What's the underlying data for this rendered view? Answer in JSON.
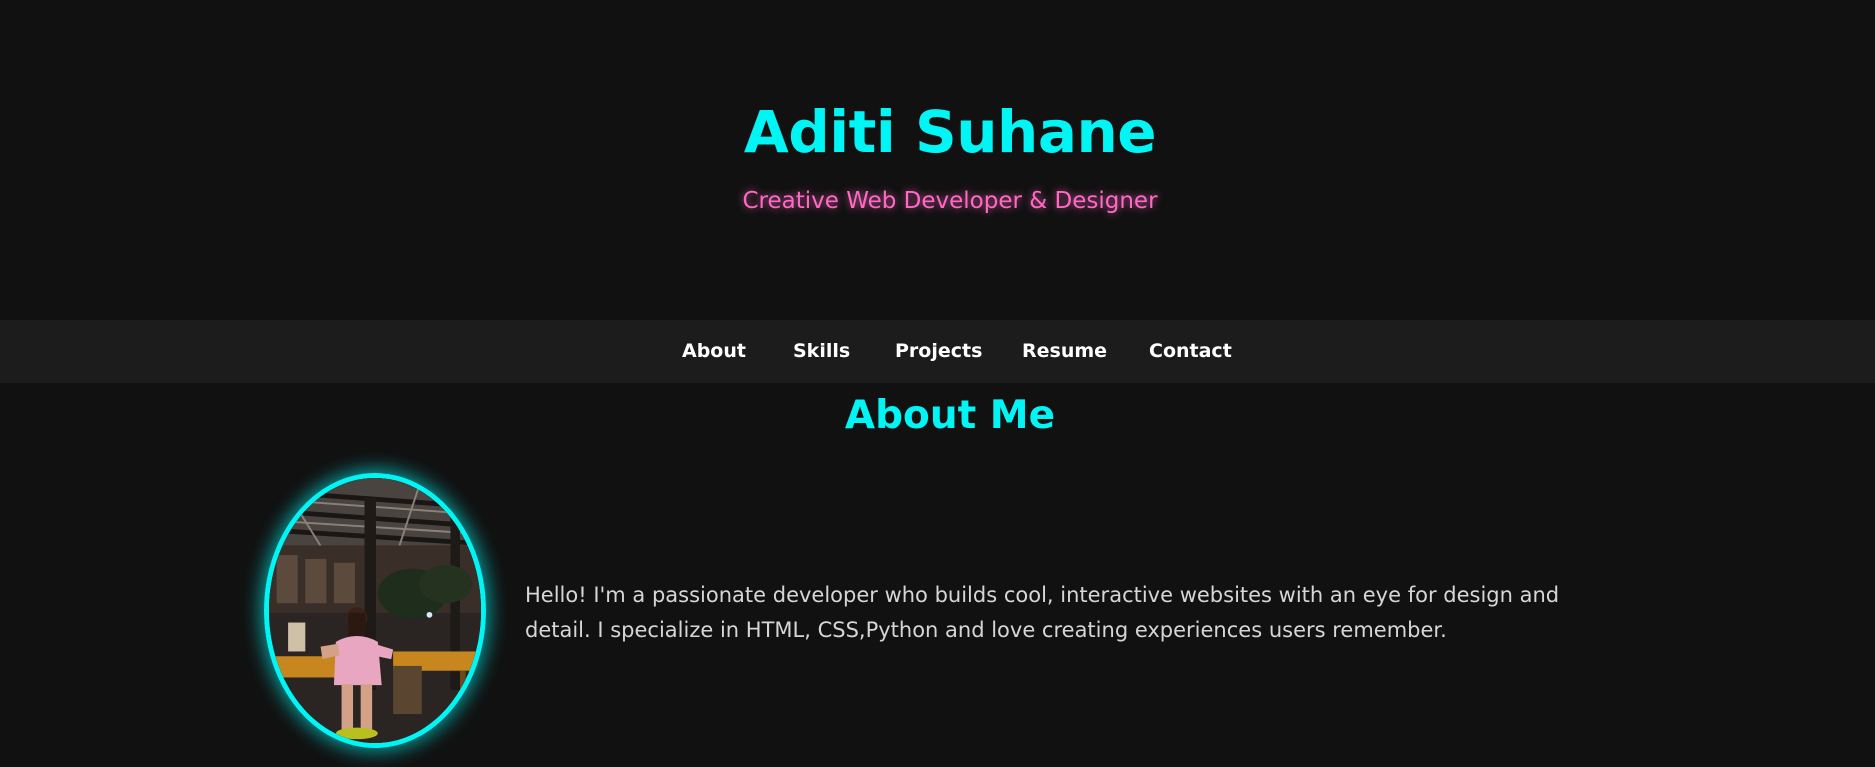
{
  "header": {
    "name": "Aditi Suhane",
    "tagline": "Creative Web Developer & Designer"
  },
  "nav": {
    "items": [
      {
        "label": "About"
      },
      {
        "label": "Skills"
      },
      {
        "label": "Projects"
      },
      {
        "label": "Resume"
      },
      {
        "label": "Contact"
      }
    ]
  },
  "about": {
    "heading": "About Me",
    "bio": "Hello! I'm a passionate developer who builds cool, interactive websites with an eye for design and detail. I specialize in HTML, CSS,Python and love creating experiences users remember."
  },
  "colors": {
    "background": "#111111",
    "nav_background": "#1c1c1c",
    "accent_cyan": "#00f5f5",
    "accent_pink": "#ff69c4",
    "body_text": "#d6d6d6"
  }
}
